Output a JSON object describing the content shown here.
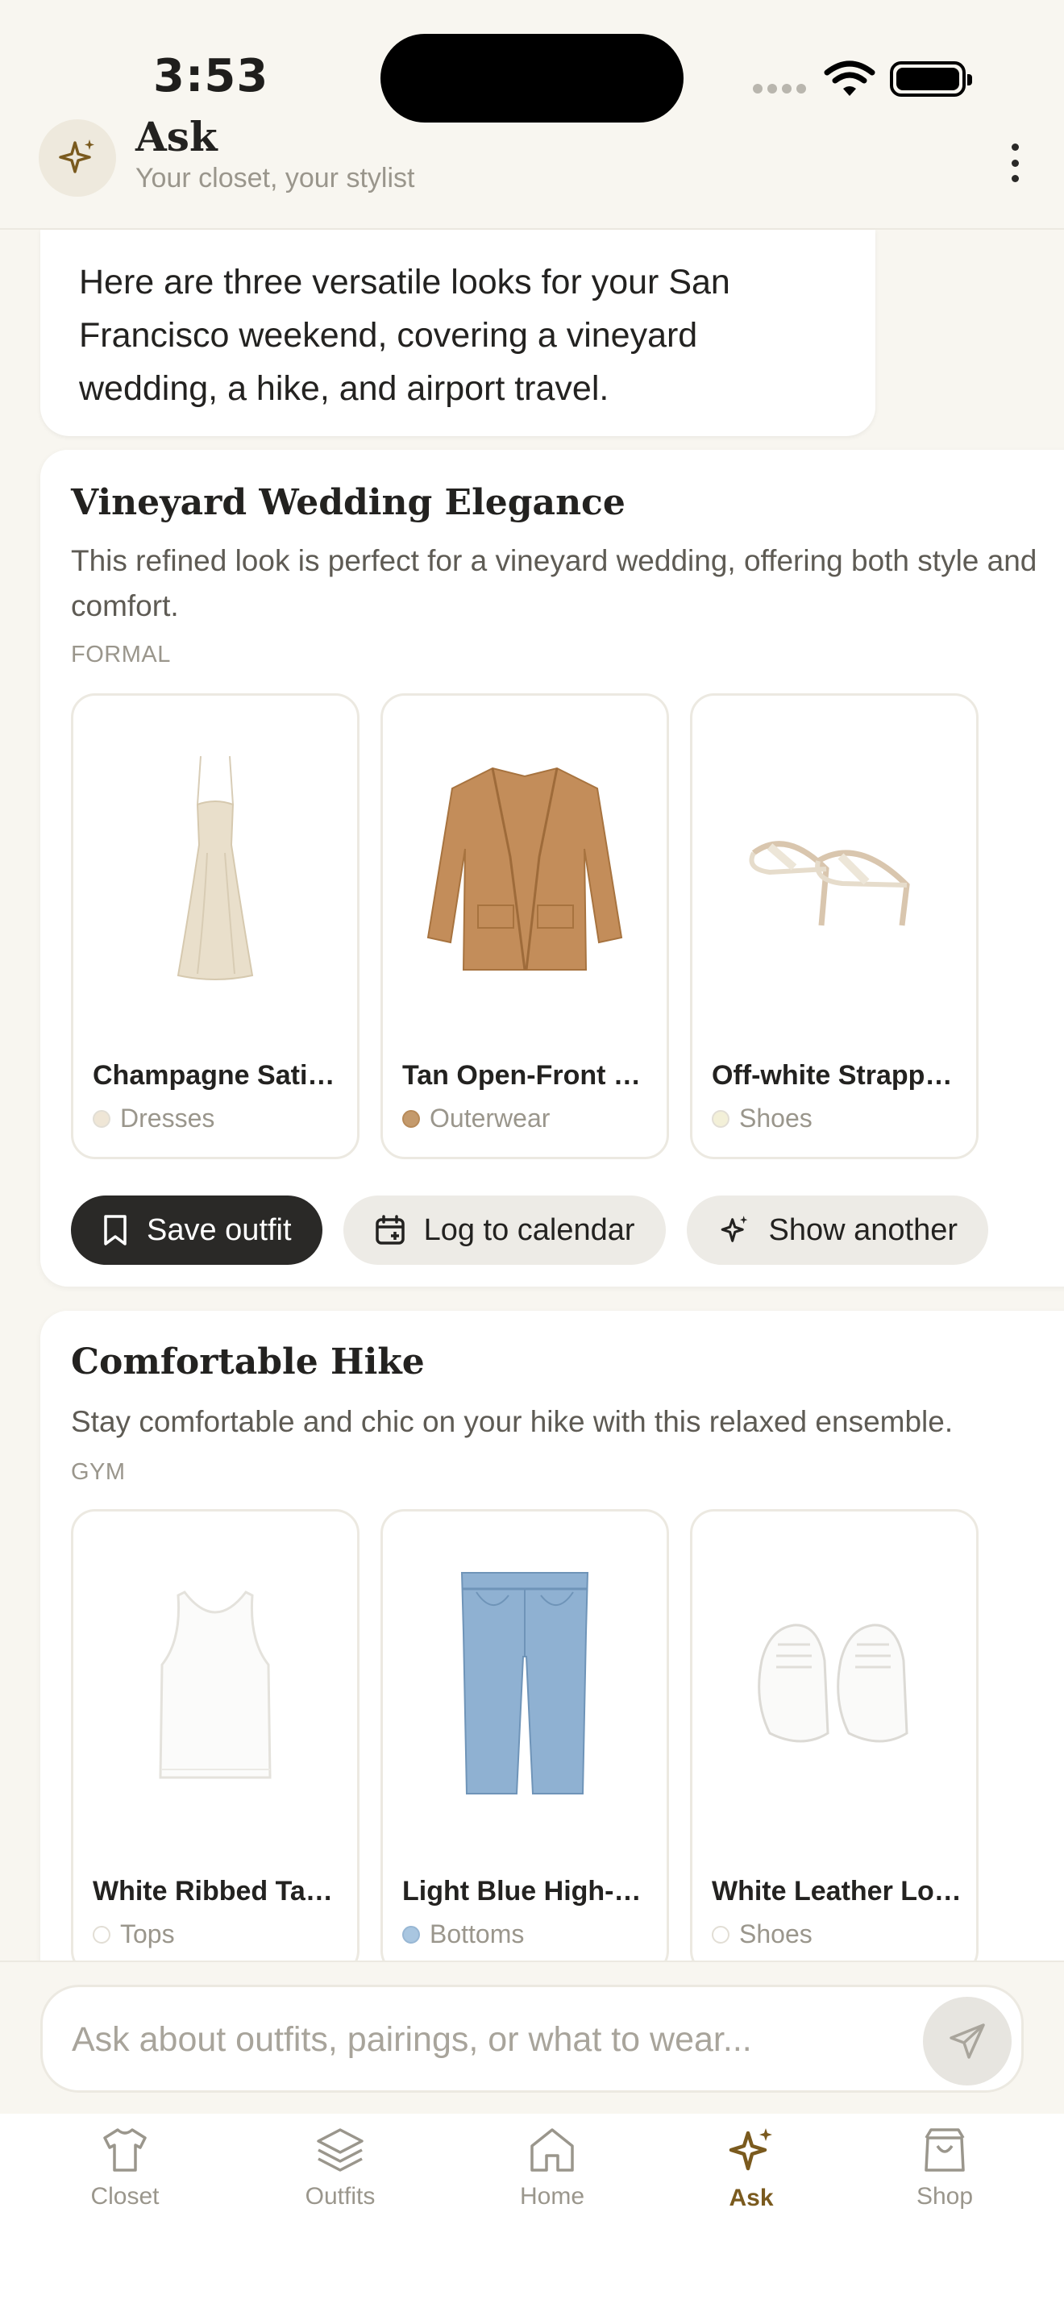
{
  "status_bar": {
    "time": "3:53"
  },
  "header": {
    "title": "Ask",
    "subtitle": "Your closet, your stylist"
  },
  "message": {
    "text": "Here are three versatile looks for your San Francisco weekend, covering a vineyard wedding, a hike, and airport travel."
  },
  "outfits": [
    {
      "title": "Vineyard Wedding Elegance",
      "description": "This refined look is perfect for a vineyard wedding, offering both style and comfort.",
      "tag": "FORMAL",
      "items": [
        {
          "name": "Champagne Satin Slip Dress",
          "category": "Dresses",
          "color": "#EFE6D6",
          "image": "dress-image"
        },
        {
          "name": "Tan Open-Front Blazer",
          "category": "Outerwear",
          "color": "#C49A6C",
          "image": "blazer-image"
        },
        {
          "name": "Off-white Strappy Heels",
          "category": "Shoes",
          "color": "#F3F0D8",
          "image": "heels-image"
        }
      ],
      "actions": {
        "save": "Save outfit",
        "calendar": "Log to calendar",
        "another": "Show another"
      }
    },
    {
      "title": "Comfortable Hike",
      "description": "Stay comfortable and chic on your hike with this relaxed ensemble.",
      "tag": "GYM",
      "items": [
        {
          "name": "White Ribbed Tank Top",
          "category": "Tops",
          "color": "#FFFFFF",
          "image": "tank-image"
        },
        {
          "name": "Light Blue High-Waisted Jeans",
          "category": "Bottoms",
          "color": "#A9C6E0",
          "image": "jeans-image"
        },
        {
          "name": "White Leather Low-Top Sneakers",
          "category": "Shoes",
          "color": "#FFFFFF",
          "image": "sneakers-image"
        }
      ]
    }
  ],
  "composer": {
    "placeholder": "Ask about outfits, pairings, or what to wear..."
  },
  "tabs": [
    {
      "label": "Closet",
      "icon": "shirt-icon"
    },
    {
      "label": "Outfits",
      "icon": "layers-icon"
    },
    {
      "label": "Home",
      "icon": "home-icon"
    },
    {
      "label": "Ask",
      "icon": "sparkle-icon",
      "active": true
    },
    {
      "label": "Shop",
      "icon": "bag-icon"
    }
  ],
  "colors": {
    "accent": "#7A5A1E",
    "background": "#F8F6F0",
    "dark_button": "#2A2927"
  }
}
